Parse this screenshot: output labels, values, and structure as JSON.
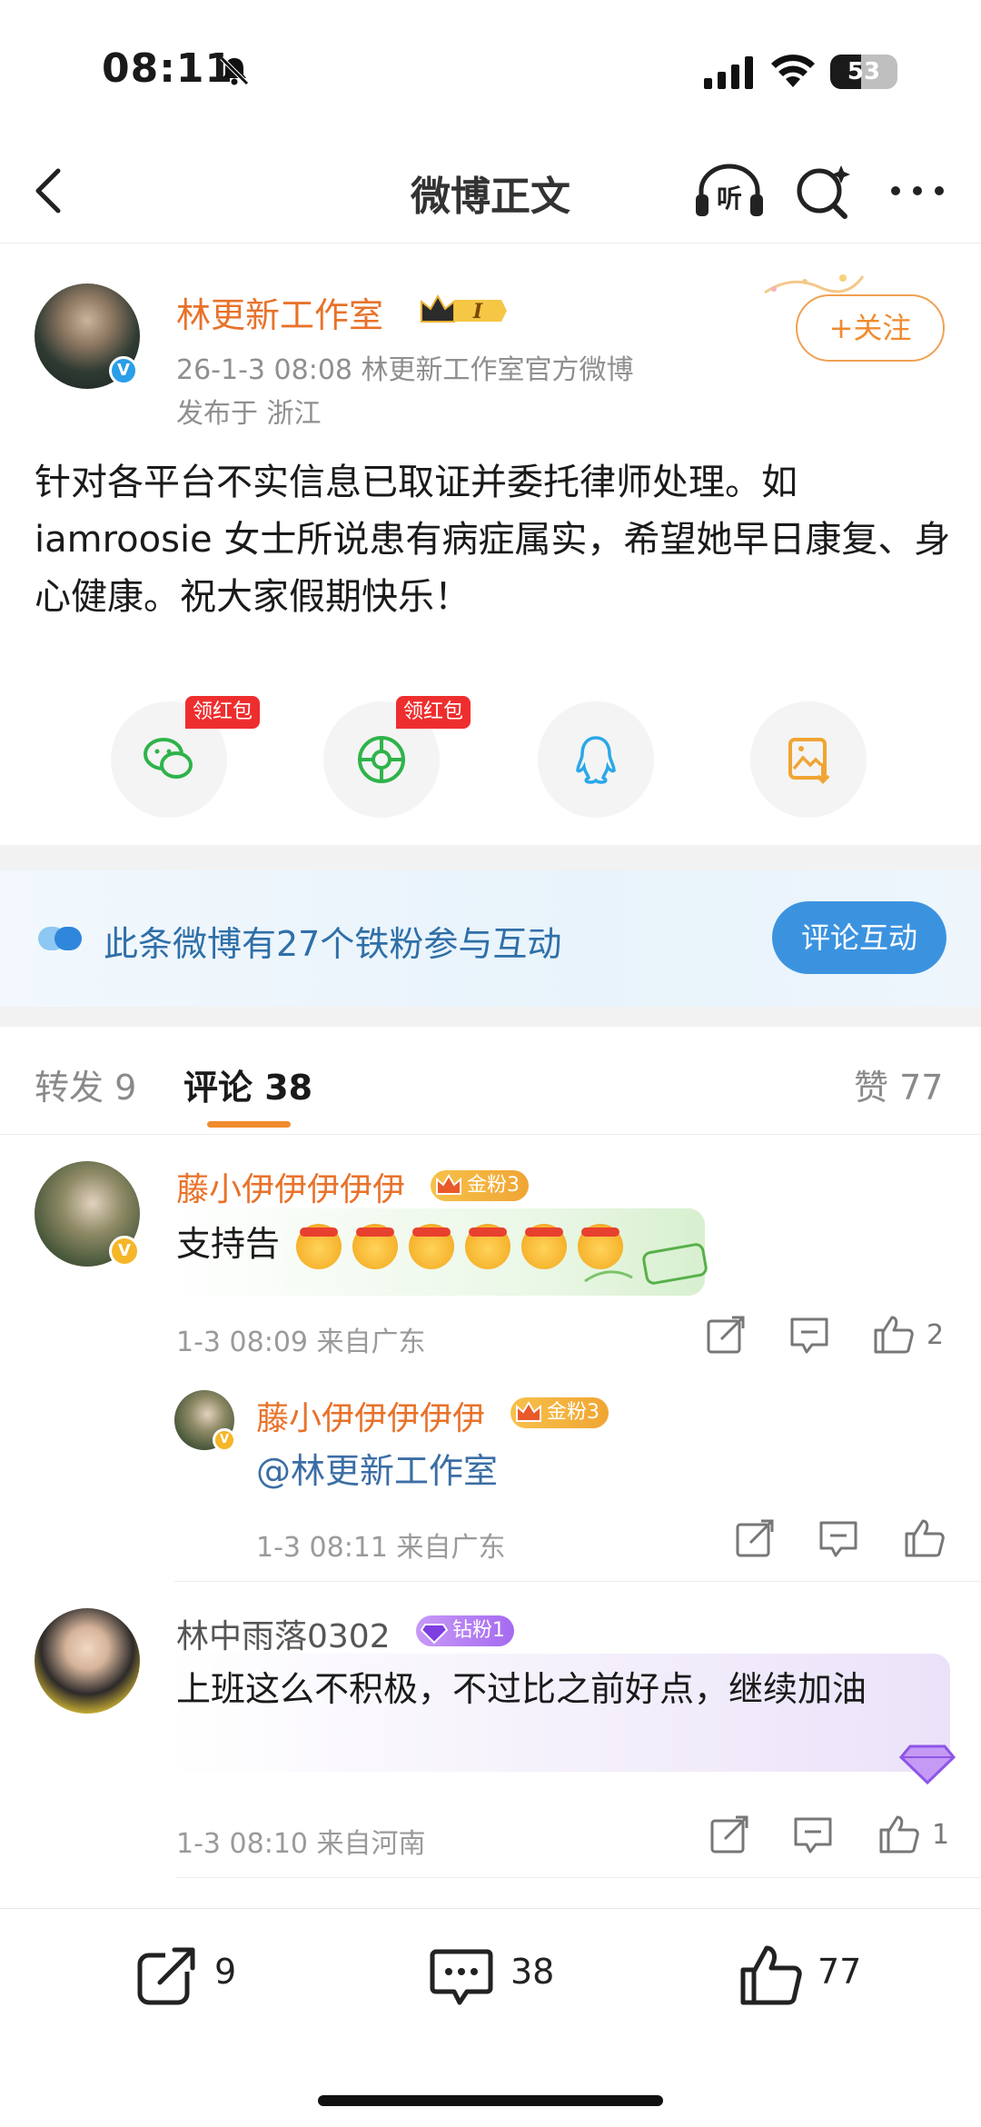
{
  "status_bar": {
    "time": "08:11",
    "battery": "53"
  },
  "nav": {
    "title": "微博正文",
    "listen_label": "听"
  },
  "post": {
    "author": "林更新工作室",
    "vip_level": "I",
    "meta": "26-1-3 08:08  林更新工作室官方微博",
    "location": "发布于 浙江",
    "follow_label": "+关注",
    "text": "针对各平台不实信息已取证并委托律师处理。如iamroosie 女士所说患有病症属实，希望她早日康复、身心健康。祝大家假期快乐！",
    "share": [
      {
        "icon": "wechat-icon",
        "tag": "领红包"
      },
      {
        "icon": "moments-icon",
        "tag": "领红包"
      },
      {
        "icon": "qq-icon",
        "tag": ""
      },
      {
        "icon": "save-image-icon",
        "tag": ""
      }
    ]
  },
  "banner": {
    "text": "此条微博有27个铁粉参与互动",
    "button": "评论互动"
  },
  "tabs": {
    "repost": "转发 9",
    "comment": "评论 38",
    "like": "赞 77"
  },
  "comments": [
    {
      "user": "藤小伊伊伊伊伊",
      "badge": "金粉3",
      "text": "支持告",
      "time": "1-3 08:09  来自广东",
      "likes": "2",
      "reply": {
        "user": "藤小伊伊伊伊伊",
        "badge": "金粉3",
        "text": "@林更新工作室",
        "time": "1-3 08:11  来自广东"
      }
    },
    {
      "user": "林中雨落0302",
      "badge": "钻粉1",
      "text": "上班这么不积极，不过比之前好点，继续加油",
      "time": "1-3 08:10  来自河南",
      "likes": "1"
    }
  ],
  "bottom_bar": {
    "reposts": "9",
    "comments": "38",
    "likes": "77"
  },
  "colors": {
    "accent_orange": "#e8722a",
    "follow_border": "#f0a052",
    "button_blue": "#3b93e0",
    "badge_gold": "#f0a534",
    "badge_purple": "#a56af0"
  }
}
